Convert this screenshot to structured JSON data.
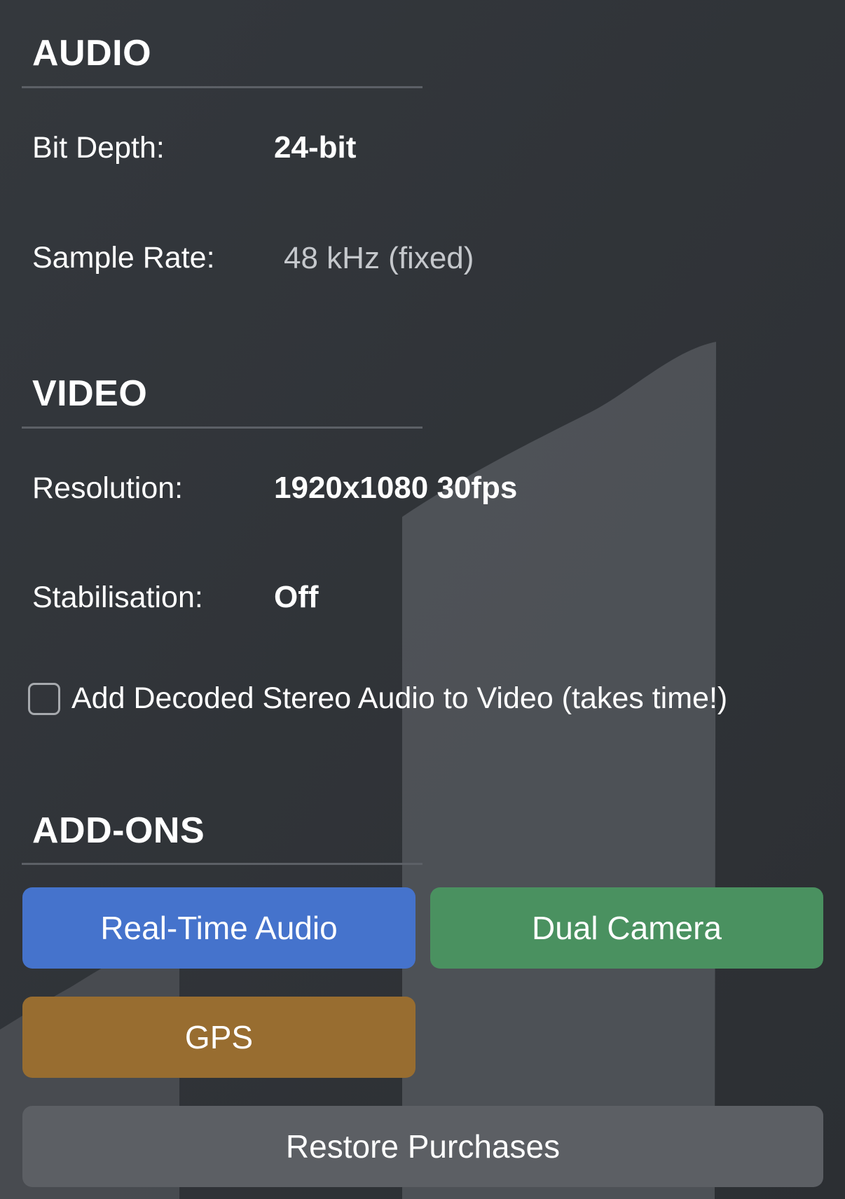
{
  "colors": {
    "background": "#2f3338",
    "realtime_audio": "#4573cc",
    "dual_camera": "#4a9160",
    "gps": "#986d30",
    "restore": "#5c5f64"
  },
  "audio": {
    "title": "AUDIO",
    "bit_depth_label": "Bit Depth:",
    "bit_depth_value": "24-bit",
    "sample_rate_label": "Sample Rate:",
    "sample_rate_value": "48 kHz (fixed)"
  },
  "video": {
    "title": "VIDEO",
    "resolution_label": "Resolution:",
    "resolution_value": "1920x1080 30fps",
    "stabilisation_label": "Stabilisation:",
    "stabilisation_value": "Off",
    "decoded_audio_label": "Add Decoded Stereo Audio to Video (takes time!)",
    "decoded_audio_checked": false
  },
  "addons": {
    "title": "ADD-ONS",
    "realtime_audio_label": "Real-Time Audio",
    "dual_camera_label": "Dual Camera",
    "gps_label": "GPS",
    "restore_label": "Restore Purchases"
  }
}
